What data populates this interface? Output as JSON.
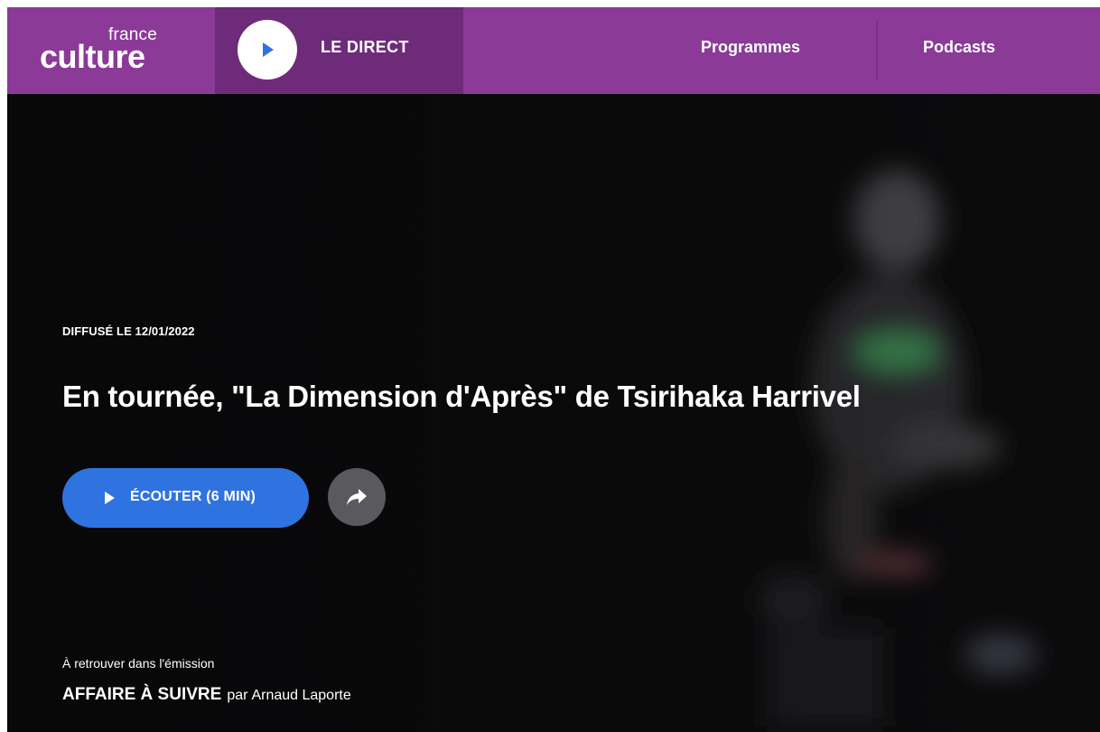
{
  "header": {
    "logo_top": "france",
    "logo_bottom": "culture",
    "live_label": "LE DIRECT",
    "nav": [
      "Programmes",
      "Podcasts"
    ]
  },
  "hero": {
    "broadcast_date": "DIFFUSÉ LE 12/01/2022",
    "title": "En tournée, \"La Dimension d'Après\" de Tsirihaka Harrivel",
    "listen_label": "ÉCOUTER (6 MIN)",
    "share_icon": "share-icon",
    "retrouver_label": "À retrouver dans l'émission",
    "program_name": "AFFAIRE À SUIVRE",
    "program_par": "par",
    "program_host": "Arnaud Laporte"
  },
  "colors": {
    "brand": "#8b3a98",
    "brand_dark": "#6e2b79",
    "accent": "#2f73e0",
    "share_bg": "#5a5a5e",
    "hero_bg": "#0b0b0c"
  }
}
